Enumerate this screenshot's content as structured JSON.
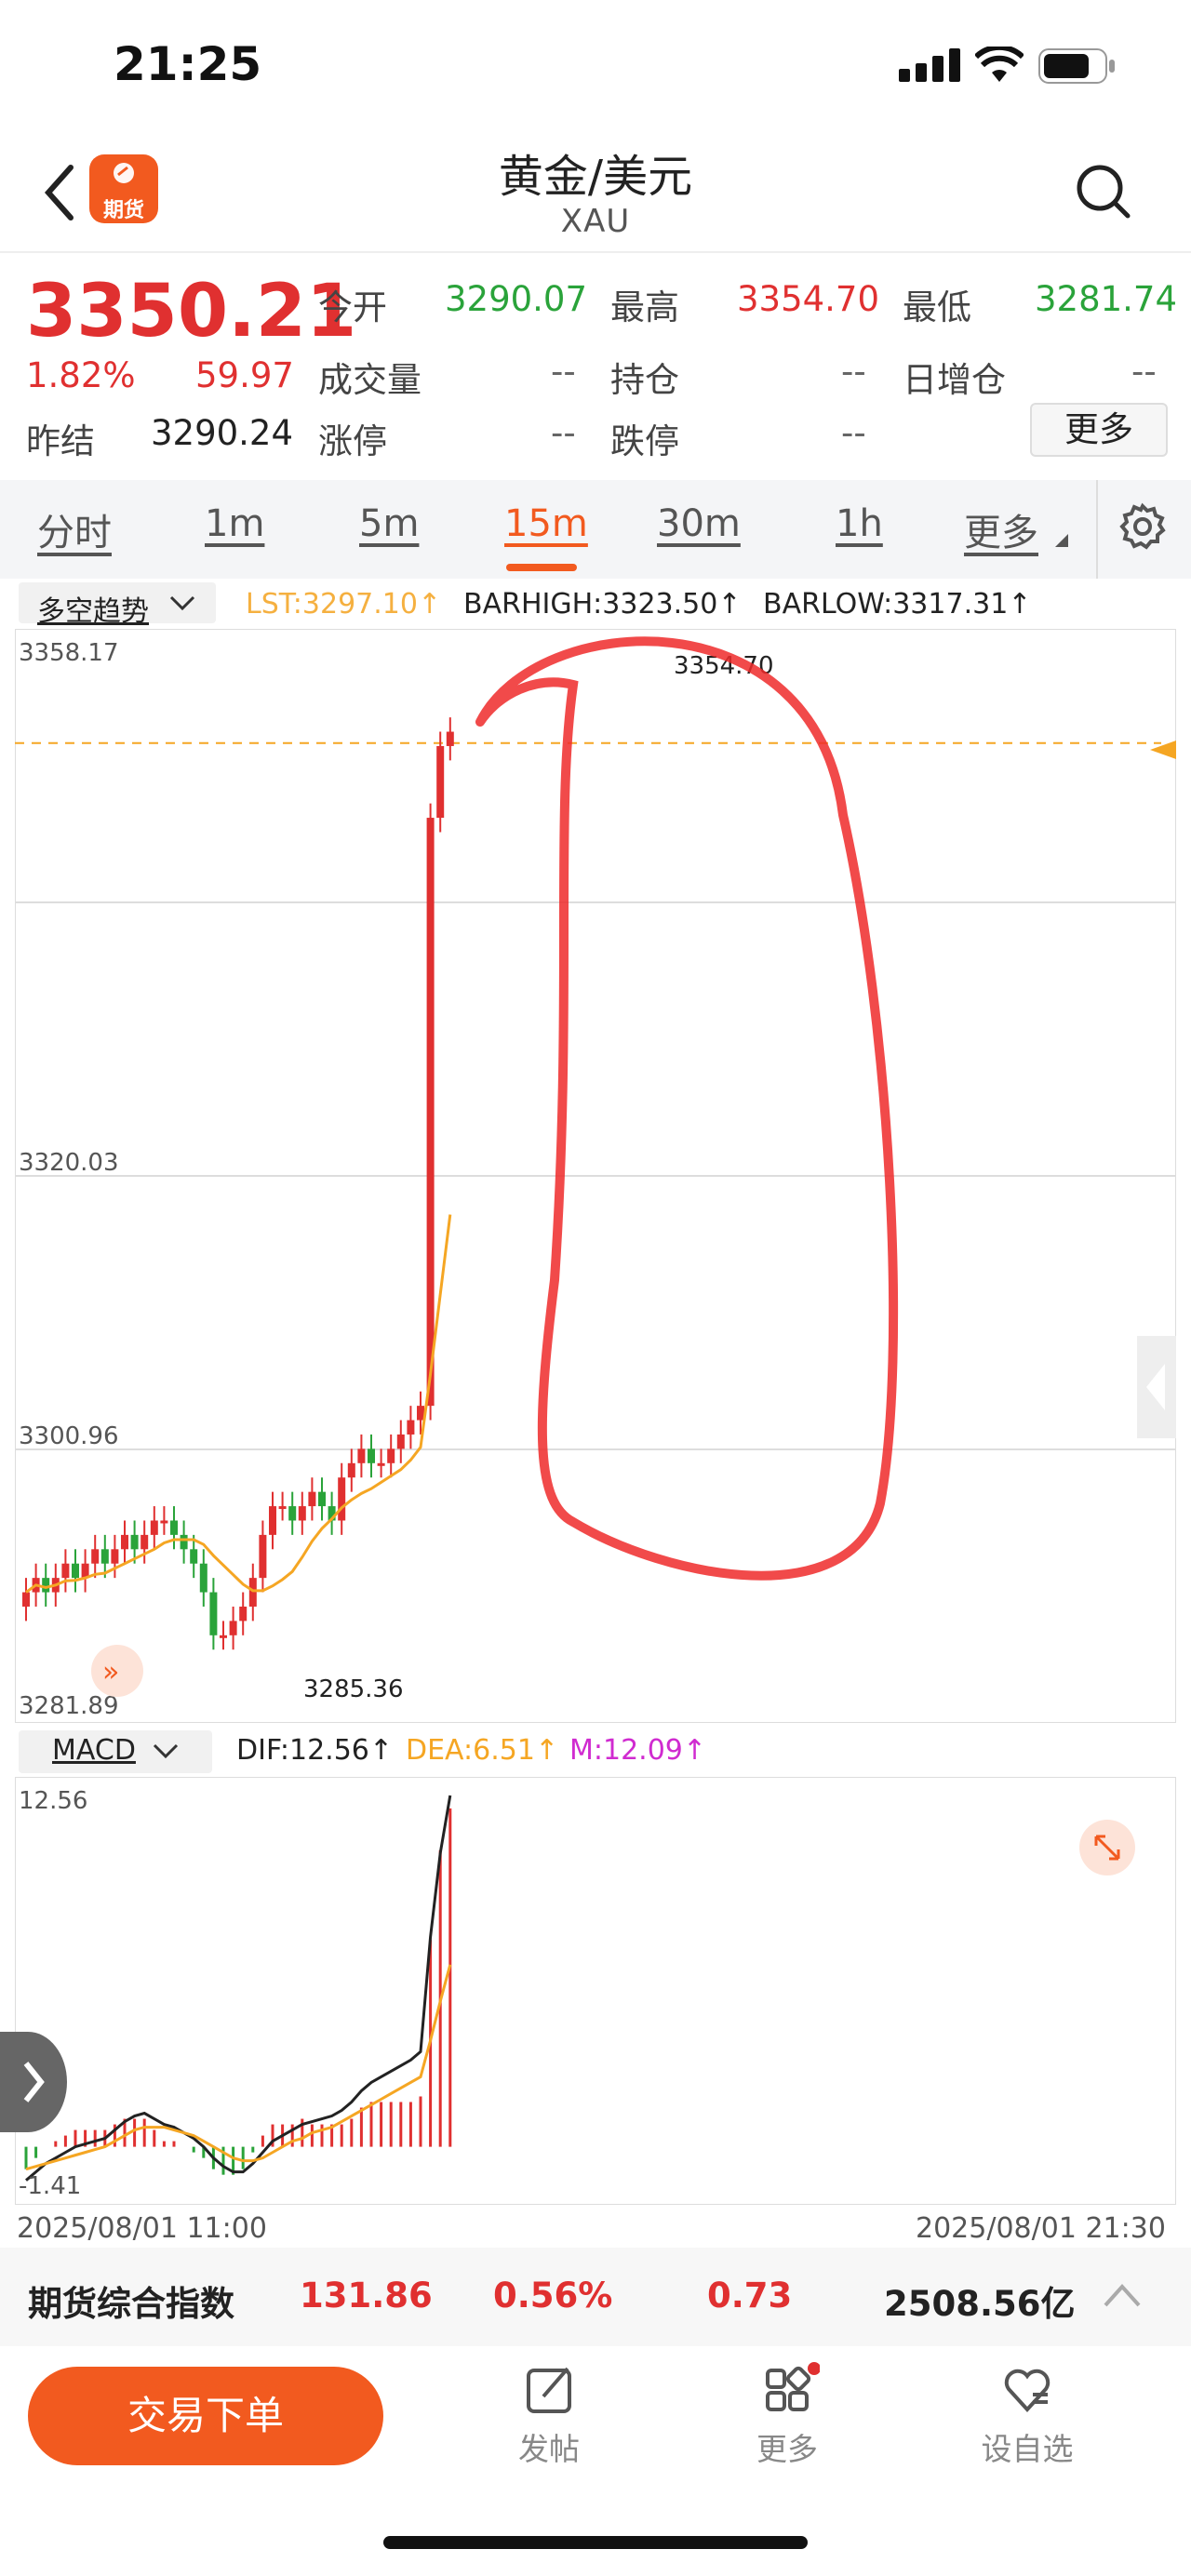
{
  "status_bar": {
    "time": "21:25"
  },
  "nav": {
    "logo_text": "期货",
    "title": "黄金/美元",
    "subtitle": "XAU"
  },
  "quote": {
    "price": "3350.21",
    "change_pct": "1.82%",
    "change_value": "59.97",
    "prev_settle_label": "昨结",
    "prev_settle_value": "3290.24",
    "open_label": "今开",
    "open_value": "3290.07",
    "high_label": "最高",
    "high_value": "3354.70",
    "low_label": "最低",
    "low_value": "3281.74",
    "volume_label": "成交量",
    "volume_value": "--",
    "position_label": "持仓",
    "position_value": "--",
    "daily_add_label": "日增仓",
    "daily_add_value": "--",
    "limit_up_label": "涨停",
    "limit_up_value": "--",
    "limit_down_label": "跌停",
    "limit_down_value": "--",
    "more_label": "更多"
  },
  "period_tabs": [
    "分时",
    "1m",
    "5m",
    "15m",
    "30m",
    "1h",
    "更多"
  ],
  "active_tab": "15m",
  "indicator": {
    "selector": "多空趋势",
    "lst": "LST:3297.10↑",
    "barhigh": "BARHIGH:3323.50↑",
    "barlow": "BARLOW:3317.31↑"
  },
  "chart_data": [
    {
      "type": "candlestick",
      "y_ticks": [
        "3358.17",
        "3320.03",
        "3300.96",
        "3281.89"
      ],
      "ylim": [
        3281.89,
        3358.17
      ],
      "max_annotation": "3354.70",
      "min_annotation": "3285.36",
      "current_price_line": 3350.21,
      "close_approx": [
        3291,
        3292,
        3291,
        3292,
        3293,
        3292,
        3293,
        3294,
        3293,
        3294,
        3295,
        3294,
        3295,
        3296,
        3296,
        3295,
        3294,
        3293,
        3291,
        3288,
        3288,
        3289,
        3290,
        3292,
        3295,
        3297,
        3297,
        3296,
        3297,
        3298,
        3297,
        3296,
        3299,
        3300,
        3301,
        3300,
        3300,
        3301,
        3302,
        3303,
        3304,
        3345,
        3350,
        3351
      ]
    },
    {
      "type": "bar",
      "name": "MACD",
      "selector": "MACD",
      "dif": "DIF:12.56↑",
      "dea": "DEA:6.51↑",
      "m": "M:12.09↑",
      "y_ticks": [
        "12.56",
        "-1.41"
      ],
      "ylim": [
        -1.41,
        12.56
      ],
      "x_start": "2025/08/01 11:00",
      "x_end": "2025/08/01 21:30",
      "dif_values": [
        -1.2,
        -0.9,
        -0.6,
        -0.4,
        -0.2,
        0.0,
        0.1,
        0.2,
        0.3,
        0.6,
        0.9,
        1.1,
        1.2,
        1.0,
        0.8,
        0.7,
        0.5,
        0.3,
        0.0,
        -0.4,
        -0.7,
        -0.9,
        -0.9,
        -0.6,
        -0.2,
        0.2,
        0.4,
        0.6,
        0.8,
        0.9,
        1.0,
        1.1,
        1.3,
        1.6,
        2.0,
        2.3,
        2.5,
        2.7,
        2.9,
        3.1,
        3.4,
        7.5,
        10.5,
        12.56
      ],
      "dea_values": [
        -0.8,
        -0.7,
        -0.6,
        -0.5,
        -0.4,
        -0.3,
        -0.2,
        -0.1,
        0.0,
        0.2,
        0.4,
        0.6,
        0.7,
        0.7,
        0.7,
        0.6,
        0.5,
        0.4,
        0.2,
        0.0,
        -0.2,
        -0.4,
        -0.5,
        -0.5,
        -0.4,
        -0.2,
        0.0,
        0.2,
        0.3,
        0.5,
        0.6,
        0.7,
        0.9,
        1.1,
        1.3,
        1.5,
        1.7,
        1.9,
        2.1,
        2.3,
        2.5,
        3.8,
        5.2,
        6.51
      ]
    }
  ],
  "index_bar": {
    "name": "期货综合指数",
    "value": "131.86",
    "pct": "0.56%",
    "change": "0.73",
    "amount": "2508.56亿"
  },
  "bottom_nav": {
    "trade": "交易下单",
    "post": "发帖",
    "more": "更多",
    "watch": "设自选"
  },
  "colors": {
    "accent": "#f25a1f",
    "up": "#e03030",
    "down": "#2aa33a",
    "dea": "#f5a623",
    "m": "#d02bd0"
  }
}
